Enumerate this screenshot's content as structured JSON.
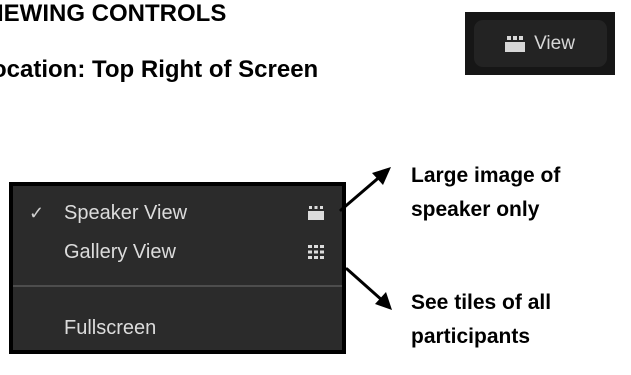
{
  "heading": {
    "title": "IEWING CONTROLS",
    "subtitle": "ocation: Top Right of Screen"
  },
  "view_button": {
    "icon": "speaker-view-icon",
    "label": "View"
  },
  "menu": {
    "items": [
      {
        "label": "Speaker View",
        "checked": true,
        "check_mark": "✓",
        "icon": "speaker-view-icon"
      },
      {
        "label": "Gallery View",
        "checked": false,
        "icon": "gallery-view-icon"
      },
      {
        "label": "Fullscreen",
        "checked": false
      }
    ]
  },
  "annotations": {
    "speaker": [
      "Large image of",
      "speaker only"
    ],
    "gallery": [
      "See tiles of all",
      "participants"
    ]
  },
  "colors": {
    "menu_background": "#2b2b2b",
    "menu_border": "#000000",
    "menu_text": "#dcdcdc",
    "chip_background": "#161616",
    "button_background": "#232323"
  }
}
